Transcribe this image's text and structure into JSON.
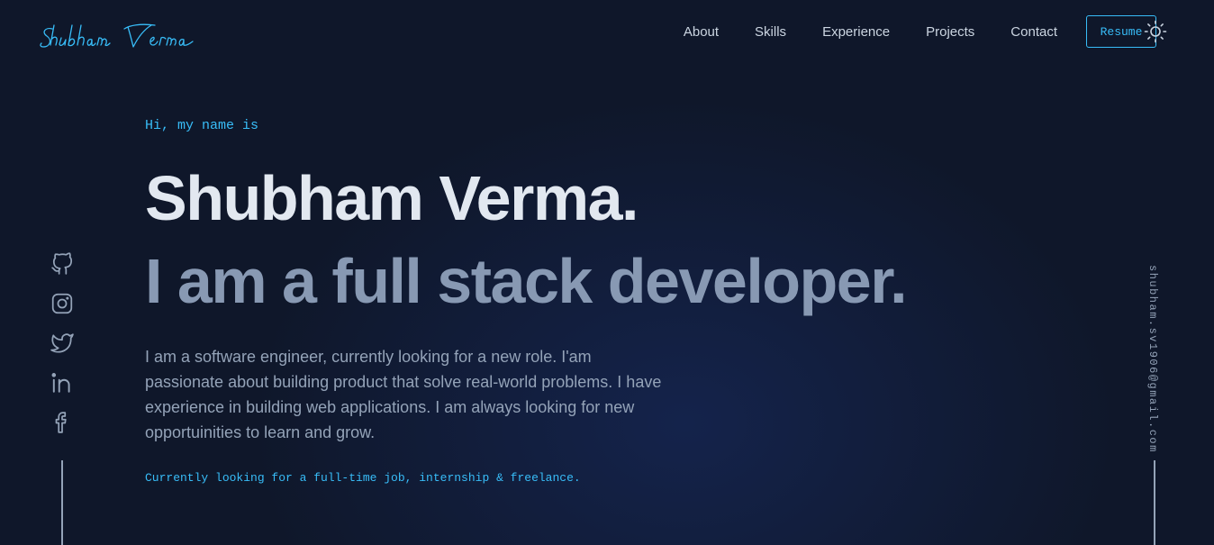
{
  "logo": {
    "text": "Shubham Verma"
  },
  "nav": {
    "links": [
      "About",
      "Skills",
      "Experience",
      "Projects",
      "Contact"
    ],
    "resume_label": "Resume",
    "theme_icon": "sun-icon"
  },
  "hero": {
    "greeting": "Hi, my name is",
    "name": "Shubham Verma.",
    "tagline": "I am a full stack developer.",
    "bio_lines": [
      "I am a software engineer, currently looking for a new role. I'am",
      "passionate about building product that solve real-world problems. I have",
      "experience in building web applications. I am always looking for new",
      "opportuinities to learn and grow."
    ],
    "status": "Currently looking for a full-time job, internship & freelance."
  },
  "social": {
    "icons": [
      "github-icon",
      "instagram-icon",
      "twitter-icon",
      "linkedin-icon",
      "facebook-icon"
    ]
  },
  "contact": {
    "email": "shubham.sv1906@gmail.com"
  },
  "colors": {
    "background": "#0f172a",
    "accent": "#38bdf8",
    "heading": "#e2e8f0",
    "subheading": "#8899b3",
    "body_text": "#94a3b8"
  }
}
